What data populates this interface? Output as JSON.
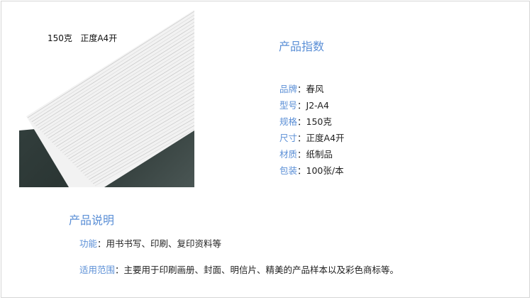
{
  "image": {
    "caption": "150克   正度A4开"
  },
  "specs": {
    "title": "产品指数",
    "items": [
      {
        "label": "品牌",
        "value": "春风"
      },
      {
        "label": "型号",
        "value": "J2-A4"
      },
      {
        "label": "规格",
        "value": "150克"
      },
      {
        "label": "尺寸",
        "value": "正度A4开"
      },
      {
        "label": "材质",
        "value": "纸制品"
      },
      {
        "label": "包装",
        "value": "100张/本"
      }
    ],
    "separator": "："
  },
  "description": {
    "title": "产品说明",
    "function_label": "功能",
    "function_value": "用书书写、印刷、复印资料等",
    "scope_label": "适用范围",
    "scope_value": "主要用于印刷画册、封面、明信片、精美的产品样本以及彩色商标等。"
  },
  "colors": {
    "accent": "#5b8fd6",
    "background_dark": "#2f3b3a",
    "border": "#d6d6d6"
  }
}
